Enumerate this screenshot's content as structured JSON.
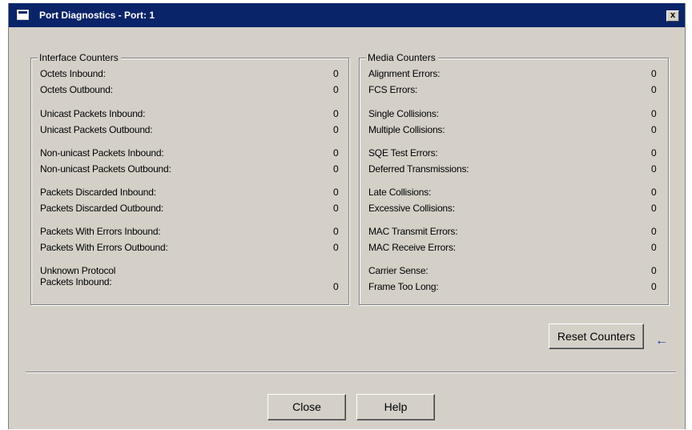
{
  "window": {
    "title": "Port Diagnostics - Port: 1",
    "close_glyph": "x",
    "title_icon": "window-icon"
  },
  "interface_counters": {
    "legend": "Interface Counters",
    "rows": [
      {
        "label": "Octets Inbound:",
        "value": "0"
      },
      {
        "label": "Octets Outbound:",
        "value": "0"
      },
      {
        "label": "Unicast Packets Inbound:",
        "value": "0"
      },
      {
        "label": "Unicast Packets Outbound:",
        "value": "0"
      },
      {
        "label": "Non-unicast Packets Inbound:",
        "value": "0"
      },
      {
        "label": "Non-unicast Packets Outbound:",
        "value": "0"
      },
      {
        "label": "Packets Discarded Inbound:",
        "value": "0"
      },
      {
        "label": "Packets Discarded Outbound:",
        "value": "0"
      },
      {
        "label": "Packets With Errors Inbound:",
        "value": "0"
      },
      {
        "label": "Packets With Errors Outbound:",
        "value": "0"
      }
    ],
    "unknown_protocol": {
      "label_line1": "Unknown Protocol",
      "label_line2": "Packets Inbound:",
      "value": "0"
    }
  },
  "media_counters": {
    "legend": "Media Counters",
    "rows": [
      {
        "label": "Alignment Errors:",
        "value": "0"
      },
      {
        "label": "FCS Errors:",
        "value": "0"
      },
      {
        "label": "Single Collisions:",
        "value": "0"
      },
      {
        "label": "Multiple Collisions:",
        "value": "0"
      },
      {
        "label": "SQE Test Errors:",
        "value": "0"
      },
      {
        "label": "Deferred Transmissions:",
        "value": "0"
      },
      {
        "label": "Late Collisions:",
        "value": "0"
      },
      {
        "label": "Excessive Collisions:",
        "value": "0"
      },
      {
        "label": "MAC Transmit Errors:",
        "value": "0"
      },
      {
        "label": "MAC Receive Errors:",
        "value": "0"
      },
      {
        "label": "Carrier Sense:",
        "value": "0"
      },
      {
        "label": "Frame Too Long:",
        "value": "0"
      }
    ]
  },
  "buttons": {
    "reset": "Reset Counters",
    "close": "Close",
    "help": "Help"
  },
  "annotation": {
    "arrow_glyph": "←",
    "arrow_color": "#1c3c9c"
  },
  "colors": {
    "titlebar": "#0a246a",
    "dialog_bg": "#d4d0c8"
  }
}
